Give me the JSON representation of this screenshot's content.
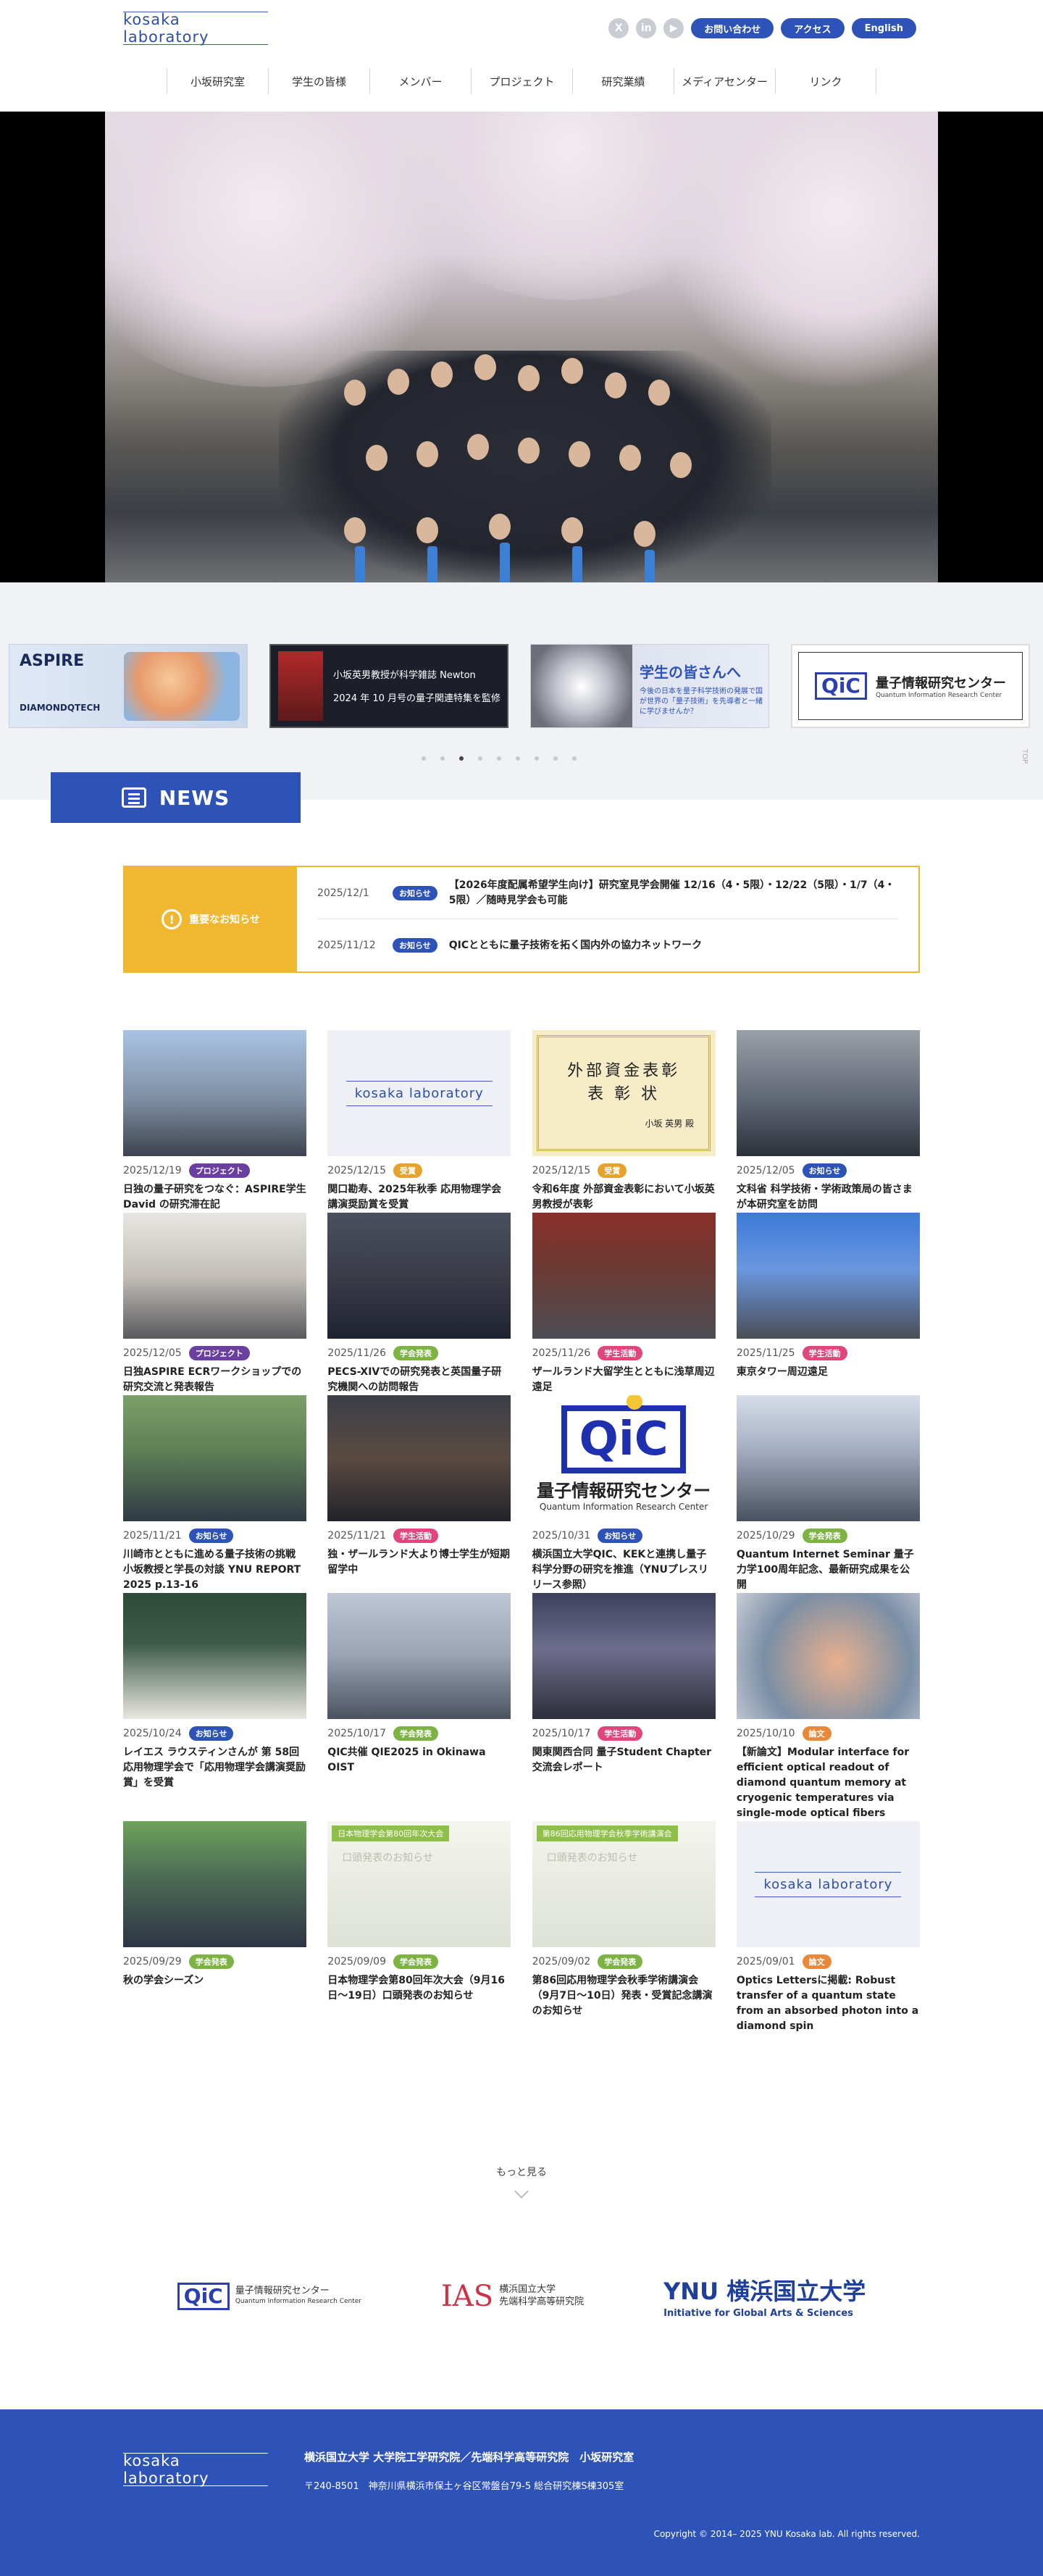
{
  "header": {
    "logo": "kosaka laboratory",
    "sns": [
      "X",
      "in",
      "▶"
    ],
    "buttons": [
      "お問い合わせ",
      "アクセス",
      "English"
    ]
  },
  "nav": [
    "小坂研究室",
    "学生の皆様",
    "メンバー",
    "プロジェクト",
    "研究業績",
    "メディアセンター",
    "リンク"
  ],
  "banners": {
    "aspire": {
      "title": "ASPIRE",
      "sub1": "DIAMONDQTECH"
    },
    "newton": {
      "line1": "小坂英男教授が科学雑誌 Newton",
      "line2": "2024 年 10 月号の量子関連特集を監修"
    },
    "students": {
      "title": "学生の皆さんへ",
      "desc": "今後の日本を量子科学技術の発展で国が世界の「量子技術」を先導者と一緒に学びませんか？"
    },
    "qic": {
      "mark": "QiC",
      "title": "量子情報研究センター",
      "sub": "Quantum Information Research Center"
    },
    "top": "TOP"
  },
  "news_heading": "NEWS",
  "notice": {
    "label": "重要なお知らせ",
    "items": [
      {
        "date": "2025/12/1",
        "cat": "お知らせ",
        "title": "【2026年度配属希望学生向け】研究室見学会開催 12/16（4・5限）・12/22（5限）・1/7（4・5限）／随時見学会も可能"
      },
      {
        "date": "2025/11/12",
        "cat": "お知らせ",
        "title": "QICとともに量子技術を拓く国内外の協力ネットワーク"
      }
    ]
  },
  "news": [
    {
      "date": "2025/12/19",
      "cat": "プロジェクト",
      "cat_color": "#6a3fa0",
      "title": "日独の量子研究をつなぐ：ASPIRE学生 David の研究滞在記"
    },
    {
      "date": "2025/12/15",
      "cat": "受賞",
      "cat_color": "#e6a32b",
      "title": "関口勘寿、2025年秋季 応用物理学会講演奨励賞を受賞"
    },
    {
      "date": "2025/12/15",
      "cat": "受賞",
      "cat_color": "#e6a32b",
      "title": "令和6年度 外部資金表彰において小坂英男教授が表彰"
    },
    {
      "date": "2025/12/05",
      "cat": "お知らせ",
      "cat_color": "#2d52b8",
      "title": "文科省 科学技術・学術政策局の皆さまが本研究室を訪問"
    },
    {
      "date": "2025/12/05",
      "cat": "プロジェクト",
      "cat_color": "#6a3fa0",
      "title": "日独ASPIRE ECRワークショップでの研究交流と発表報告"
    },
    {
      "date": "2025/11/26",
      "cat": "学会発表",
      "cat_color": "#7cb342",
      "title": "PECS-XIVでの研究発表と英国量子研究機関への訪問報告"
    },
    {
      "date": "2025/11/26",
      "cat": "学生活動",
      "cat_color": "#e0457b",
      "title": "ザールランド大留学生とともに浅草周辺遠足"
    },
    {
      "date": "2025/11/25",
      "cat": "学生活動",
      "cat_color": "#e0457b",
      "title": "東京タワー周辺遠足"
    },
    {
      "date": "2025/11/21",
      "cat": "お知らせ",
      "cat_color": "#2d52b8",
      "title": "川崎市とともに進める量子技術の挑戦 小坂教授と学長の対談 YNU REPORT 2025 p.13-16"
    },
    {
      "date": "2025/11/21",
      "cat": "学生活動",
      "cat_color": "#e0457b",
      "title": "独・ザールランド大より博士学生が短期留学中"
    },
    {
      "date": "2025/10/31",
      "cat": "お知らせ",
      "cat_color": "#2d52b8",
      "title": "横浜国立大学QIC、KEKと連携し量子科学分野の研究を推進（YNUプレスリリース参照）"
    },
    {
      "date": "2025/10/29",
      "cat": "学会発表",
      "cat_color": "#7cb342",
      "title": "Quantum Internet Seminar 量子力学100周年記念、最新研究成果を公開"
    },
    {
      "date": "2025/10/24",
      "cat": "お知らせ",
      "cat_color": "#2d52b8",
      "title": "レイエス ラウスティンさんが 第 58回応用物理学会で「応用物理学会講演奨励賞」を受賞"
    },
    {
      "date": "2025/10/17",
      "cat": "学会発表",
      "cat_color": "#7cb342",
      "title": "QIC共催 QIE2025 in Okinawa OIST"
    },
    {
      "date": "2025/10/17",
      "cat": "学生活動",
      "cat_color": "#e0457b",
      "title": "関東関西合同 量子Student Chapter 交流会レポート"
    },
    {
      "date": "2025/10/10",
      "cat": "論文",
      "cat_color": "#e8893a",
      "title": "【新論文】Modular interface for efficient optical readout of diamond quantum memory at cryogenic temperatures via single-mode optical fibers"
    },
    {
      "date": "2025/09/29",
      "cat": "学会発表",
      "cat_color": "#7cb342",
      "title": "秋の学会シーズン"
    },
    {
      "date": "2025/09/09",
      "cat": "学会発表",
      "cat_color": "#7cb342",
      "title": "日本物理学会第80回年次大会（9月16日〜19日）口頭発表のお知らせ"
    },
    {
      "date": "2025/09/02",
      "cat": "学会発表",
      "cat_color": "#7cb342",
      "title": "第86回応用物理学会秋季学術講演会（9月7日〜10日）発表・受賞記念講演のお知らせ"
    },
    {
      "date": "2025/09/01",
      "cat": "論文",
      "cat_color": "#e8893a",
      "title": "Optics Lettersに掲載: Robust transfer of a quantum state from an absorbed photon into a diamond spin"
    }
  ],
  "thumbs": {
    "logo": "kosaka laboratory",
    "cert_title": "外部資金表彰",
    "cert_sub": "表 彰 状",
    "cert_name": "小坂 英男 殿",
    "qic_mark": "QiC",
    "qic_title": "量子情報研究センター",
    "qic_sub": "Quantum Information Research Center",
    "ann1_tag": "日本物理学会第80回年次大会",
    "ann1_sub": "口頭発表のお知らせ",
    "ann2_tag": "第86回応用物理学会秋季学術講演会",
    "ann2_sub": "口頭発表のお知らせ"
  },
  "more": "もっと見る",
  "partners": {
    "qic_mark": "QiC",
    "qic_title": "量子情報研究センター",
    "qic_sub": "Quantum Information Research Center",
    "ias_mark": "IAS",
    "ias_line1": "横浜国立大学",
    "ias_line2": "先端科学高等研究院",
    "ynu_mark": "YNU 横浜国立大学",
    "ynu_sub": "Initiative for Global Arts & Sciences"
  },
  "footer": {
    "logo": "kosaka laboratory",
    "org": "横浜国立大学  大学院工学研究院／先端科学高等研究院　小坂研究室",
    "address": "〒240-8501　神奈川県横浜市保土ヶ谷区常盤台79-5 総合研究棟S棟305室",
    "copyright": "Copyright © 2014– 2025 YNU Kosaka lab. All rights reserved."
  }
}
